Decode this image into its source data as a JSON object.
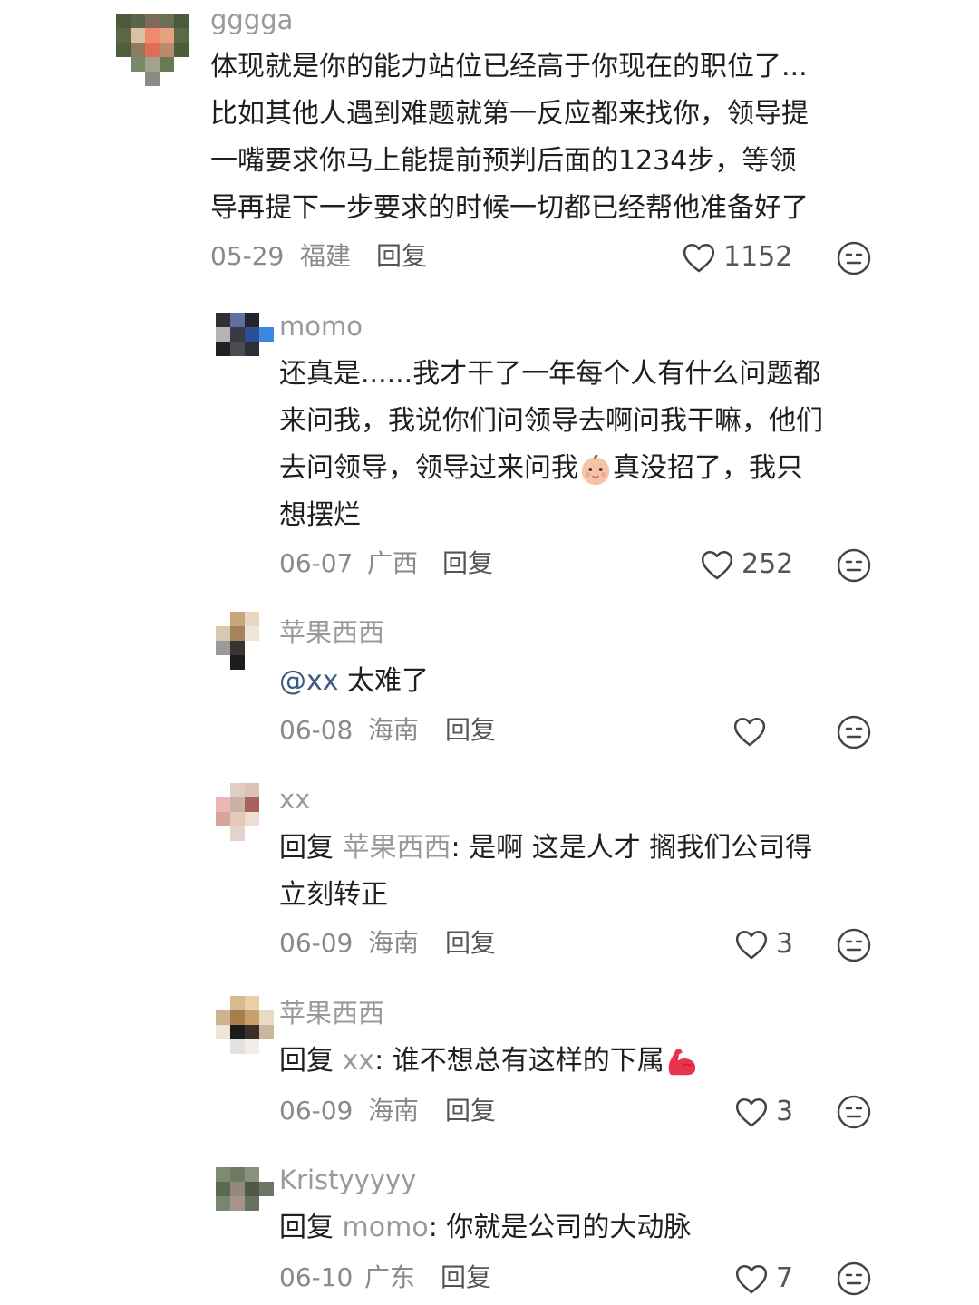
{
  "comments": [
    {
      "username": "gggga",
      "lines": [
        "体现就是你的能力站位已经高于你现在的职位了...",
        "比如其他人遇到难题就第一反应都来找你，领导提",
        "一嘴要求你马上能提前预判后面的1234步，等领",
        "导再提下一步要求的时候一切都已经帮他准备好了"
      ],
      "date": "05-29",
      "location": "福建",
      "reply_label": "回复",
      "likes": "1152"
    },
    {
      "username": "momo",
      "lines": [
        "还真是......我才干了一年每个人有什么问题都",
        "来问我，我说你们问领导去啊问我干嘛，他们",
        "去问领导，领导过来问我",
        "真没招了，我只",
        "想摆烂"
      ],
      "date": "06-07",
      "location": "广西",
      "reply_label": "回复",
      "likes": "252"
    },
    {
      "username": "苹果西西",
      "mention": "@xx",
      "text": " 太难了",
      "date": "06-08",
      "location": "海南",
      "reply_label": "回复",
      "likes": ""
    },
    {
      "username": "xx",
      "reply_prefix": "回复 ",
      "reply_to": "苹果西西",
      "lines": [
        ": 是啊 这是人才 搁我们公司得",
        "立刻转正"
      ],
      "date": "06-09",
      "location": "海南",
      "reply_label": "回复",
      "likes": "3"
    },
    {
      "username": "苹果西西",
      "reply_prefix": "回复 ",
      "reply_to": "xx",
      "text": ": 谁不想总有这样的下属",
      "date": "06-09",
      "location": "海南",
      "reply_label": "回复",
      "likes": "3"
    },
    {
      "username": "Kristyyyyy",
      "reply_prefix": "回复 ",
      "reply_to": "momo",
      "text": ": 你就是公司的大动脉",
      "date": "06-10",
      "location": "广东",
      "reply_label": "回复",
      "likes": "7"
    }
  ],
  "icons": {
    "like": "heart-outline-icon",
    "dislike": "neutral-face-icon",
    "emoji_1": "baby-face-emoji",
    "emoji_2": "flexed-biceps-emoji"
  },
  "colors": {
    "text": "#1f1f1f",
    "username": "#9a9a9a",
    "meta": "#8a8a8a",
    "mention": "#3d5a80",
    "emoji_red": "#e8354b"
  }
}
